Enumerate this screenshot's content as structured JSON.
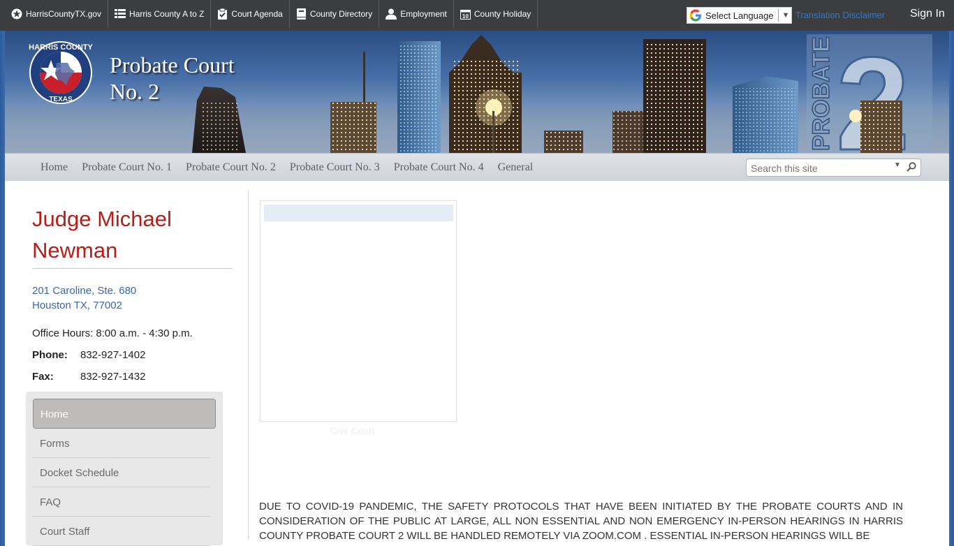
{
  "top_links": [
    {
      "label": "HarrisCountyTX.gov",
      "icon": "star-icon"
    },
    {
      "label": "Harris County A to Z",
      "icon": "list-icon"
    },
    {
      "label": "Court Agenda",
      "icon": "clipboard-icon"
    },
    {
      "label": "County Directory",
      "icon": "book-icon"
    },
    {
      "label": "Employment",
      "icon": "user-icon"
    },
    {
      "label": "County Holiday",
      "icon": "calendar-icon"
    }
  ],
  "language": {
    "label": "Select Language",
    "disclaimer": "Translation Disclaimer"
  },
  "signin": "Sign In",
  "banner": {
    "title_line1": "Probate Court",
    "title_line2": "No. 2",
    "seal_top": "HARRIS COUNTY",
    "seal_bottom": "TEXAS",
    "badge_word": "PROBATE",
    "badge_number": "2"
  },
  "nav": [
    "Home",
    "Probate Court No. 1",
    "Probate Court No. 2",
    "Probate Court No. 3",
    "Probate Court No. 4",
    "General"
  ],
  "search": {
    "placeholder": "Search this site"
  },
  "judge": {
    "name": "Judge Michael Newman",
    "address_line1": "201 Caroline, Ste. 680",
    "address_line2": "Houston TX, 77002",
    "office_hours": "Office Hours:  8:00 a.m. - 4:30 p.m.",
    "phone_label": "Phone:",
    "phone": "832-927-1402",
    "fax_label": "Fax:",
    "fax": "832-927-1432"
  },
  "side_menu": [
    "Home",
    "Forms",
    "Docket Schedule",
    "FAQ",
    "Court Staff"
  ],
  "image_caption": "Civil Court",
  "notice": "DUE TO COVID-19 PANDEMIC, THE SAFETY PROTOCOLS THAT HAVE BEEN INITIATED BY THE PROBATE COURTS AND IN CONSIDERATION OF THE PUBLIC AT LARGE, ALL NON ESSENTIAL AND NON EMERGENCY IN-PERSON HEARINGS IN HARRIS COUNTY PROBATE COURT 2 WILL BE HANDLED REMOTELY VIA ZOOM.COM . ESSENTIAL IN-PERSON HEARINGS WILL BE",
  "colors": {
    "topbar": "#3c3d3f",
    "judge_name": "#b81d18",
    "address": "#3a67a8",
    "link_blue": "#2a7ad6"
  }
}
